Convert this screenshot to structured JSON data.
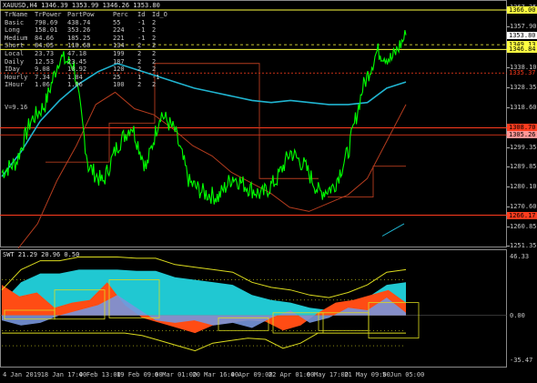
{
  "header": {
    "symbol": "XAUUSD,H4",
    "ohlc": "1346.39 1353.99 1346.26 1353.80"
  },
  "table": {
    "columns": [
      "TrName",
      "TrPower",
      "PartPow",
      "Perc",
      "Id",
      "Id_O"
    ],
    "rows": [
      [
        "Basic",
        "790.69",
        "438.74",
        "55",
        "-1",
        "2"
      ],
      [
        "Long",
        "158.01",
        "353.26",
        "224",
        "-1",
        "2"
      ],
      [
        "Medium",
        "84.66",
        "185.25",
        "221",
        "-1",
        "2"
      ],
      [
        "Short",
        "84.05",
        "110.68",
        "134",
        "2",
        "2"
      ],
      [
        "Local",
        "23.73",
        "47.18",
        "199",
        "2",
        "2"
      ],
      [
        "Daily",
        "12.53",
        "23.45",
        "187",
        "2",
        "2"
      ],
      [
        "IDay",
        "9.08",
        "10.92",
        "120",
        "2",
        "2"
      ],
      [
        "Hourly",
        "7.34",
        "1.84",
        "25",
        "1",
        "-1"
      ],
      [
        "IHour",
        "1.06",
        "1.06",
        "100",
        "2",
        "2"
      ]
    ],
    "v_line": "V=9.16"
  },
  "swt_header": "SWT 21.29 20.96 0.50",
  "colors": {
    "price": "#00ff00",
    "cyan_ma": "#20b4d0",
    "level": "#ffff40",
    "red_line": "#ff3c1e",
    "brown": "#b43c1e",
    "osc_cyan": "#20c8d2",
    "osc_red": "#ff4c14",
    "osc_blue": "#7896dc",
    "band": "#dcdc1e"
  },
  "price_axis": {
    "ticks": [
      "1367.35",
      "1357.90",
      "1348.00",
      "1338.10",
      "1328.35",
      "1318.60",
      "1308.70",
      "1299.35",
      "1289.85",
      "1280.10",
      "1270.60",
      "1260.85",
      "1251.35"
    ],
    "tags": [
      {
        "label": "1366.00",
        "bg": "#ffff40",
        "fg": "#000000"
      },
      {
        "label": "1353.80",
        "bg": "#ffffff",
        "fg": "#000000"
      },
      {
        "label": "1349.13",
        "bg": "#ffff40",
        "fg": "#000000"
      },
      {
        "label": "1346.84",
        "bg": "#ffff40",
        "fg": "#000000"
      },
      {
        "label": "1335.37",
        "bg": "#000000",
        "fg": "#ff3c1e"
      },
      {
        "label": "1308.70",
        "bg": "#ff3c1e",
        "fg": "#000000"
      },
      {
        "label": "1305.26",
        "bg": "#ff9696",
        "fg": "#000000"
      },
      {
        "label": "1266.17",
        "bg": "#ff3c1e",
        "fg": "#000000"
      }
    ]
  },
  "osc_axis": {
    "ticks": [
      "46.33",
      "0.00",
      "-35.47"
    ]
  },
  "time_axis": {
    "labels": [
      "4 Jan 2019",
      "18 Jan 17:00",
      "4 Feb 13:00",
      "19 Feb 09:00",
      "6 Mar 01:00",
      "20 Mar 16:00",
      "4 Apr 09:00",
      "22 Apr 01:00",
      "6 May 17:00",
      "21 May 09:00",
      "5 Jun 05:00"
    ]
  },
  "chart_data": [
    {
      "type": "line",
      "title": "XAUUSD,H4",
      "ylim": [
        1251.35,
        1370.0
      ],
      "x": [
        "4 Jan 2019",
        "18 Jan 17:00",
        "4 Feb 13:00",
        "19 Feb 09:00",
        "6 Mar 01:00",
        "20 Mar 16:00",
        "4 Apr 09:00",
        "22 Apr 01:00",
        "6 May 17:00",
        "21 May 09:00",
        "5 Jun 05:00"
      ],
      "series": [
        {
          "values": [
            1287,
            1292,
            1312,
            1320,
            1343,
            1339,
            1290,
            1282,
            1300,
            1310,
            1289,
            1316,
            1307,
            1282,
            1277,
            1275,
            1285,
            1280,
            1276,
            1283,
            1297,
            1290,
            1277,
            1280,
            1297,
            1328,
            1346,
            1342,
            1353.8
          ]
        },
        {
          "values": [
            1285,
            1297,
            1312,
            1322,
            1330,
            1336,
            1340,
            1337,
            1334,
            1331,
            1328,
            1326,
            1324,
            1322,
            1321,
            1322,
            1321,
            1320,
            1320,
            1321,
            1328,
            1331
          ]
        },
        {
          "values": [
            1250,
            1262,
            1283,
            1300,
            1320,
            1326,
            1318,
            1315,
            1308,
            1300,
            1295,
            1287,
            1282,
            1277,
            1270,
            1268,
            1272,
            1276,
            1284,
            1302,
            1320
          ]
        },
        {
          "values": [
            1256,
            1259,
            1262
          ]
        }
      ],
      "levels": [
        1366.0,
        1349.13,
        1346.84,
        1335.37,
        1308.7,
        1305.26,
        1266.17
      ]
    },
    {
      "type": "area",
      "title": "SWT 21.29 20.96 0.50",
      "ylim": [
        -35.47,
        46.33
      ],
      "x": [
        "4 Jan 2019",
        "18 Jan 17:00",
        "4 Feb 13:00",
        "19 Feb 09:00",
        "6 Mar 01:00",
        "20 Mar 16:00",
        "4 Apr 09:00",
        "22 Apr 01:00",
        "6 May 17:00",
        "21 May 09:00",
        "5 Jun 05:00"
      ],
      "series": [
        {
          "values": [
            10,
            26,
            33,
            33,
            36,
            36,
            36,
            35,
            35,
            30,
            28,
            26,
            24,
            16,
            12,
            10,
            6,
            4,
            8,
            14,
            24,
            26
          ]
        },
        {
          "values": [
            24,
            15,
            18,
            6,
            10,
            12,
            26,
            8,
            -2,
            -6,
            -10,
            -14,
            -8,
            -6,
            -4,
            -5,
            -12,
            -8,
            2,
            10,
            12,
            16,
            20,
            10
          ]
        },
        {
          "values": [
            -4,
            -8,
            -6,
            0,
            4,
            8,
            16,
            6,
            -4,
            -6,
            -4,
            -8,
            -6,
            -10,
            -2,
            4,
            -6,
            -2,
            6,
            4,
            14,
            2
          ]
        }
      ]
    }
  ]
}
